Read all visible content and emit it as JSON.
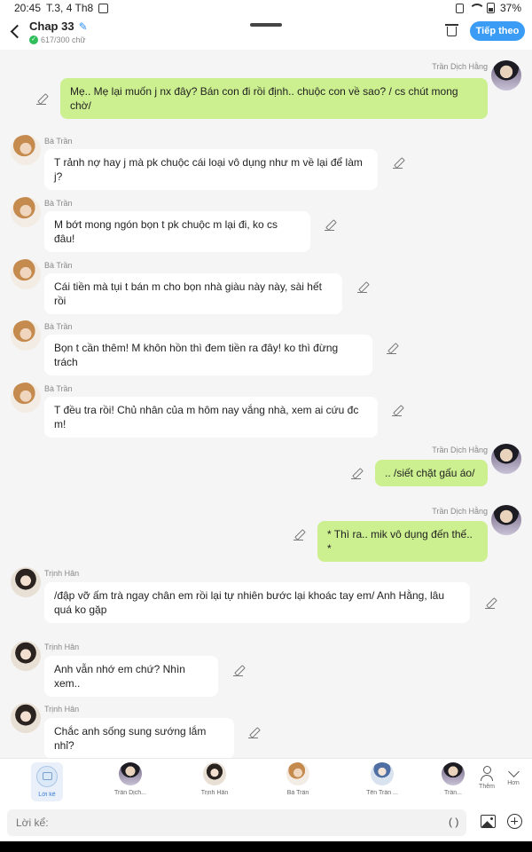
{
  "status": {
    "time": "20:45",
    "date": "T.3, 4 Th8",
    "battery": "37%"
  },
  "header": {
    "title": "Chap 33",
    "word_count": "617/300 chữ",
    "next_label": "Tiếp theo"
  },
  "messages": [
    {
      "speaker": "Trần Dịch Hằng",
      "text": "Mẹ.. Mẹ lại muốn j nx đây? Bán con đi rồi định.. chuộc con về sao? / cs chút mong chờ/"
    },
    {
      "speaker": "Bà Trần",
      "text": "T rảnh nợ hay j mà pk chuộc cái loại vô dụng như m về lại để làm j?"
    },
    {
      "speaker": "Bà Trần",
      "text": "M bớt mong ngón bọn t pk chuộc m lại đi, ko cs đâu!"
    },
    {
      "speaker": "Bà Trần",
      "text": "Cái tiền mà tụi t bán m cho bọn nhà giàu này này, sài hết rồi"
    },
    {
      "speaker": "Bà Trần",
      "text": "Bọn t cần thêm! M khôn hồn thì đem tiền ra đây! ko thì đừng trách"
    },
    {
      "speaker": "Bà Trần",
      "text": "T đều tra rồi! Chủ nhân của m hôm nay vắng nhà, xem ai cứu đc m!"
    },
    {
      "speaker": "Trần Dịch Hằng",
      "text": ".. /siết chặt gấu áo/"
    },
    {
      "speaker": "Trần Dịch Hằng",
      "text": "* Thì ra.. mik vô dụng đến thế.. *"
    },
    {
      "speaker": "Trịnh Hân",
      "text": "/đập vỡ ấm trà ngay chân em rồi lại tự nhiên bước lại khoác tay em/ Anh Hằng, lâu quá ko gặp"
    },
    {
      "speaker": "Trịnh Hân",
      "text": "Anh vẫn nhớ em chứ? Nhìn xem.."
    },
    {
      "speaker": "Trịnh Hân",
      "text": "Chắc anh sống sung sướng lắm nhỉ?"
    }
  ],
  "characters": [
    {
      "label": "Lời kể"
    },
    {
      "label": "Trần Dịch..."
    },
    {
      "label": "Trịnh Hân"
    },
    {
      "label": "Bà Trần"
    },
    {
      "label": "Tên Trần ..."
    },
    {
      "label": "Trần..."
    }
  ],
  "toolbar": {
    "add_label": "Thêm",
    "more_label": "Hơn"
  },
  "composer": {
    "placeholder": "Lời kể:",
    "paren": "( )"
  }
}
